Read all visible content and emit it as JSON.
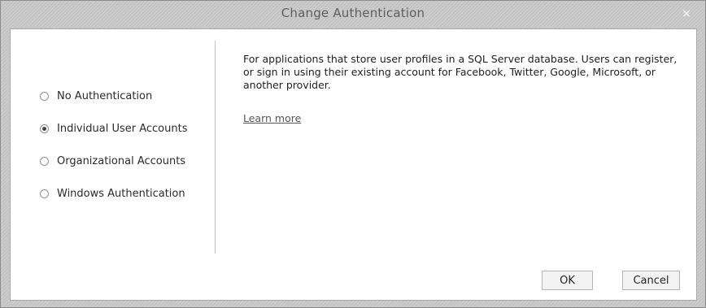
{
  "window": {
    "title": "Change Authentication",
    "close_glyph": "×"
  },
  "auth_options": [
    {
      "label": "No Authentication",
      "selected": false
    },
    {
      "label": "Individual User Accounts",
      "selected": true
    },
    {
      "label": "Organizational Accounts",
      "selected": false
    },
    {
      "label": "Windows Authentication",
      "selected": false
    }
  ],
  "details": {
    "description": "For applications that store user profiles in a SQL Server database. Users can register, or sign in using their existing account for Facebook, Twitter, Google, Microsoft, or another provider.",
    "learn_more": "Learn more"
  },
  "buttons": {
    "ok": "OK",
    "cancel": "Cancel"
  }
}
